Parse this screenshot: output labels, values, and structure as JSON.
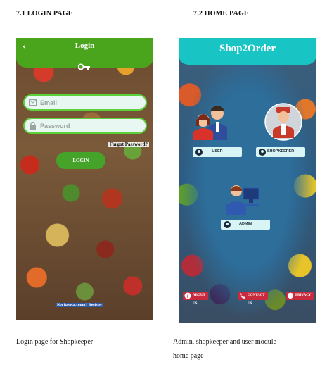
{
  "sections": {
    "login_heading": "7.1 LOGIN PAGE",
    "home_heading": "7.2  HOME PAGE"
  },
  "login_screen": {
    "title": "Login",
    "back_glyph": "‹",
    "email_placeholder": "Email",
    "password_placeholder": "Password",
    "forgot_link": "Forgot Password?",
    "login_button": "LOGIN",
    "register_link": "Not have account? Register",
    "accent_color": "#4aa51c"
  },
  "home_screen": {
    "title": "Shop2Order",
    "user_button": "USER",
    "shopkeeper_button": "SHOPKEEPER",
    "admin_button": "ADMIN",
    "footer": {
      "about": "ABOUT US",
      "contact": "CONTACT US",
      "privacy": "PRIVACY"
    },
    "accent_color": "#19c4c4"
  },
  "captions": {
    "login": "Login page for Shopkeeper",
    "home_line1": "Admin, shopkeeper and user module",
    "home_line2": "home page"
  },
  "icons": [
    "back-icon",
    "key-icon",
    "email-icon",
    "lock-icon",
    "user-icon",
    "shopkeeper-icon",
    "admin-icon",
    "about-icon",
    "contact-icon",
    "privacy-icon"
  ]
}
